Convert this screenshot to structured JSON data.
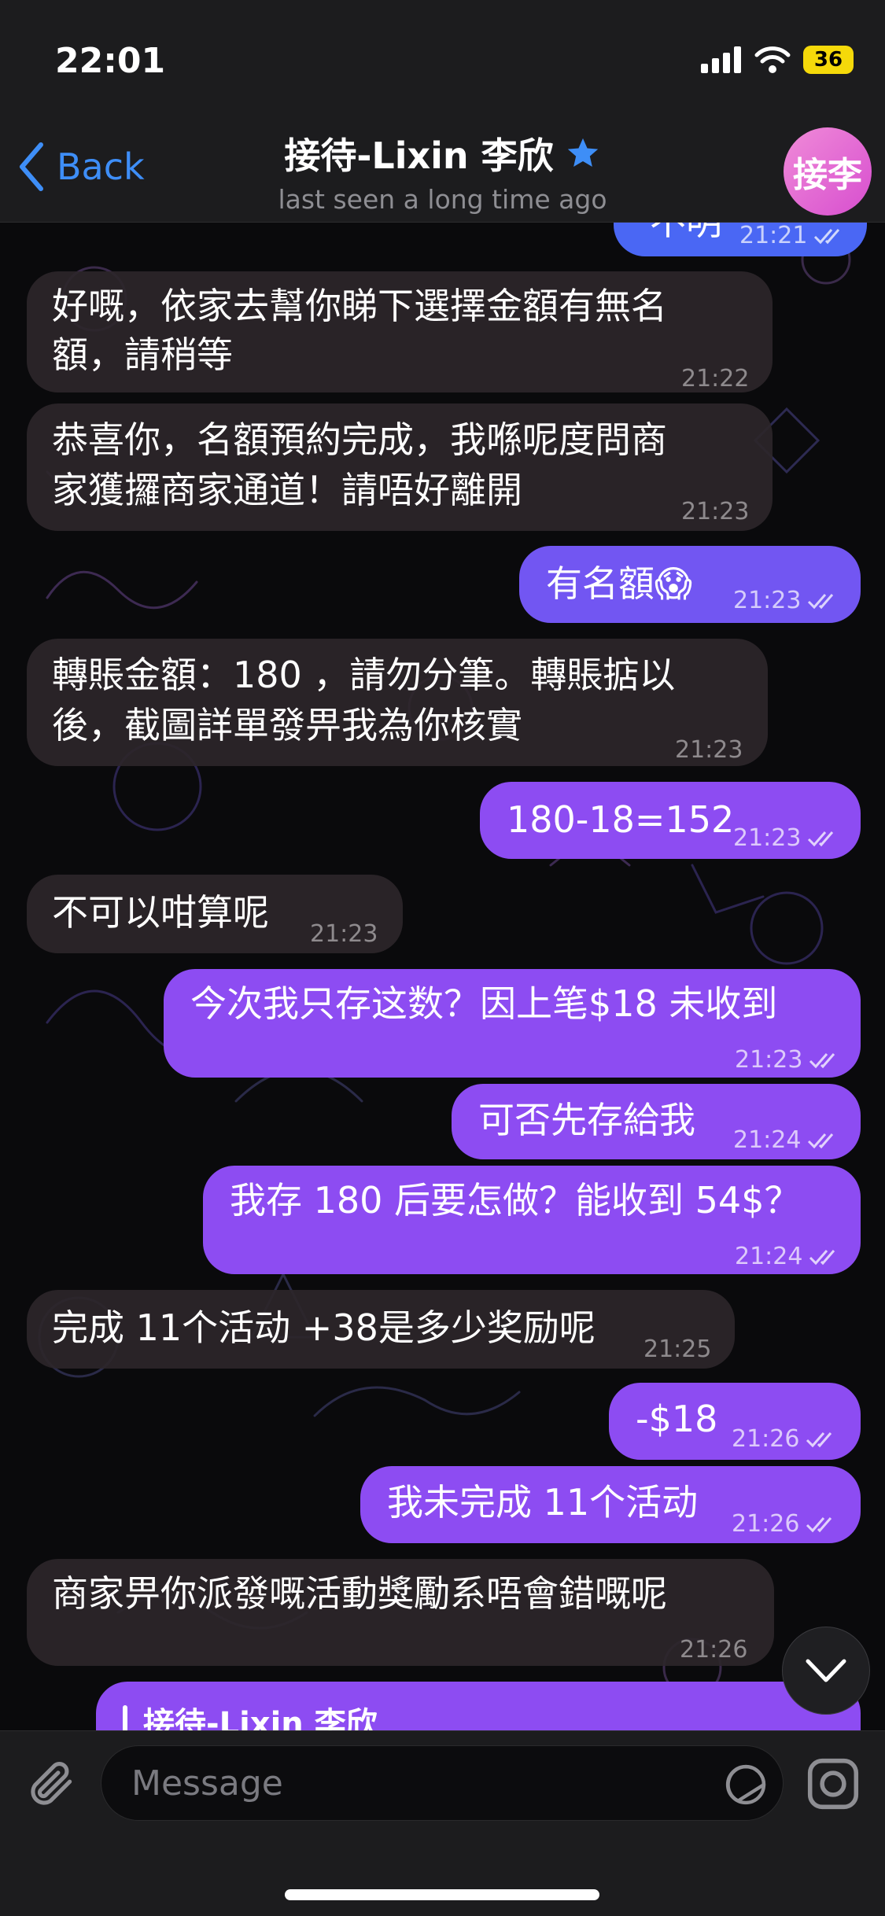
{
  "status_bar": {
    "time": "22:01",
    "battery": "36"
  },
  "header": {
    "back_label": "Back",
    "title": "接待-Lixin 李欣",
    "subtitle": "last seen a long time ago",
    "avatar_initials": "接李"
  },
  "messages": [
    {
      "dir": "out",
      "text": "不明",
      "time": "21:21",
      "read": true
    },
    {
      "dir": "in",
      "text_lines": [
        "好嘅，依家去幫你睇下選擇金額有無名",
        "額，請稍等"
      ],
      "time": "21:22"
    },
    {
      "dir": "in",
      "text_lines": [
        "恭喜你，名額預約完成，我喺呢度問商",
        "家獲攞商家通道！請唔好離開"
      ],
      "time": "21:23"
    },
    {
      "dir": "out",
      "text": "有名額😱",
      "time": "21:23",
      "read": true
    },
    {
      "dir": "in",
      "text_lines": [
        "轉賬金額：180 ，請勿分筆。轉賬掂以",
        "後，截圖詳單發畀我為你核實"
      ],
      "time": "21:23"
    },
    {
      "dir": "out",
      "text": "180-18=152",
      "time": "21:23",
      "read": true
    },
    {
      "dir": "in",
      "text": "不可以咁算呢",
      "time": "21:23"
    },
    {
      "dir": "out",
      "text": "今次我只存这数？因上笔$18 未收到",
      "time": "21:23",
      "read": true
    },
    {
      "dir": "out",
      "text": "可否先存給我",
      "time": "21:24",
      "read": true
    },
    {
      "dir": "out",
      "text": "我存 180 后要怎做？能收到 54$？",
      "time": "21:24",
      "read": true
    },
    {
      "dir": "in",
      "text": "完成 11个活动 +38是多少奖励呢",
      "time": "21:25"
    },
    {
      "dir": "out",
      "text": "-$18",
      "time": "21:26",
      "read": true
    },
    {
      "dir": "out",
      "text": "我未完成 11个活动",
      "time": "21:26",
      "read": true
    },
    {
      "dir": "in",
      "text": "商家畀你派發嘅活動獎勵系唔會錯嘅呢",
      "time": "21:26"
    },
    {
      "dir": "out",
      "reply_name": "接待-Lixin 李欣"
    }
  ],
  "composer": {
    "placeholder": "Message"
  },
  "icons": [
    "back-chevron-icon",
    "verified-star-icon",
    "signal-icon",
    "wifi-icon",
    "attach-icon",
    "sticker-icon",
    "camera-icon",
    "chevron-down-icon",
    "read-checks-icon"
  ],
  "colors": {
    "incoming": "#2c262a",
    "outgoing_blue": "#4a67f4",
    "outgoing_purple": "#8d4cf2",
    "accent": "#3e8ef7"
  }
}
